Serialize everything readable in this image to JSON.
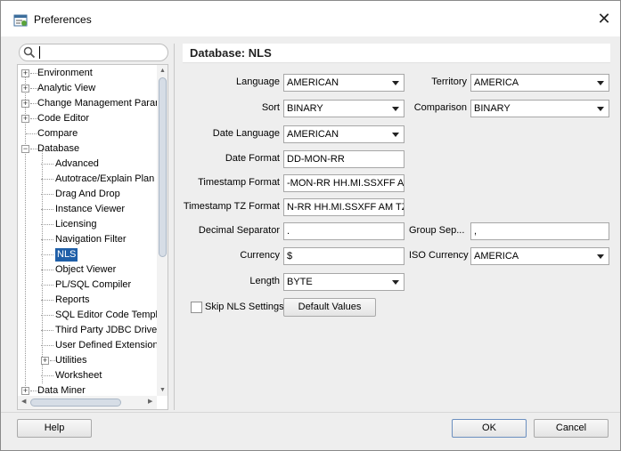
{
  "window": {
    "title": "Preferences"
  },
  "tree": {
    "items": [
      {
        "label": "Environment",
        "expander": "+"
      },
      {
        "label": "Analytic View",
        "expander": "+"
      },
      {
        "label": "Change Management Paran",
        "expander": "+"
      },
      {
        "label": "Code Editor",
        "expander": "+"
      },
      {
        "label": "Compare",
        "expander": ""
      },
      {
        "label": "Database",
        "expander": "−"
      },
      {
        "label": "Advanced",
        "expander": ""
      },
      {
        "label": "Autotrace/Explain Plan",
        "expander": ""
      },
      {
        "label": "Drag And Drop",
        "expander": ""
      },
      {
        "label": "Instance Viewer",
        "expander": ""
      },
      {
        "label": "Licensing",
        "expander": ""
      },
      {
        "label": "Navigation Filter",
        "expander": ""
      },
      {
        "label": "NLS",
        "expander": ""
      },
      {
        "label": "Object Viewer",
        "expander": ""
      },
      {
        "label": "PL/SQL Compiler",
        "expander": ""
      },
      {
        "label": "Reports",
        "expander": ""
      },
      {
        "label": "SQL Editor Code Templa",
        "expander": ""
      },
      {
        "label": "Third Party JDBC Driver",
        "expander": ""
      },
      {
        "label": "User Defined Extension",
        "expander": ""
      },
      {
        "label": "Utilities",
        "expander": "+"
      },
      {
        "label": "Worksheet",
        "expander": ""
      },
      {
        "label": "Data Miner",
        "expander": "+"
      }
    ],
    "selected": "NLS"
  },
  "panel": {
    "title": "Database: NLS",
    "language_label": "Language",
    "language_value": "AMERICAN",
    "territory_label": "Territory",
    "territory_value": "AMERICA",
    "sort_label": "Sort",
    "sort_value": "BINARY",
    "comparison_label": "Comparison",
    "comparison_value": "BINARY",
    "date_language_label": "Date Language",
    "date_language_value": "AMERICAN",
    "date_format_label": "Date Format",
    "date_format_value": "DD-MON-RR",
    "timestamp_format_label": "Timestamp Format",
    "timestamp_format_value": "-MON-RR HH.MI.SSXFF AM",
    "timestamp_tz_format_label": "Timestamp TZ Format",
    "timestamp_tz_format_value": "N-RR HH.MI.SSXFF AM TZR",
    "decimal_separator_label": "Decimal Separator",
    "decimal_separator_value": ".",
    "group_separator_label": "Group Sep...",
    "group_separator_value": ",",
    "currency_label": "Currency",
    "currency_value": "$",
    "iso_currency_label": "ISO Currency",
    "iso_currency_value": "AMERICA",
    "length_label": "Length",
    "length_value": "BYTE",
    "skip_nls_label": "Skip NLS Settings",
    "default_values_label": "Default Values"
  },
  "footer": {
    "help_label": "Help",
    "ok_label": "OK",
    "cancel_label": "Cancel"
  }
}
